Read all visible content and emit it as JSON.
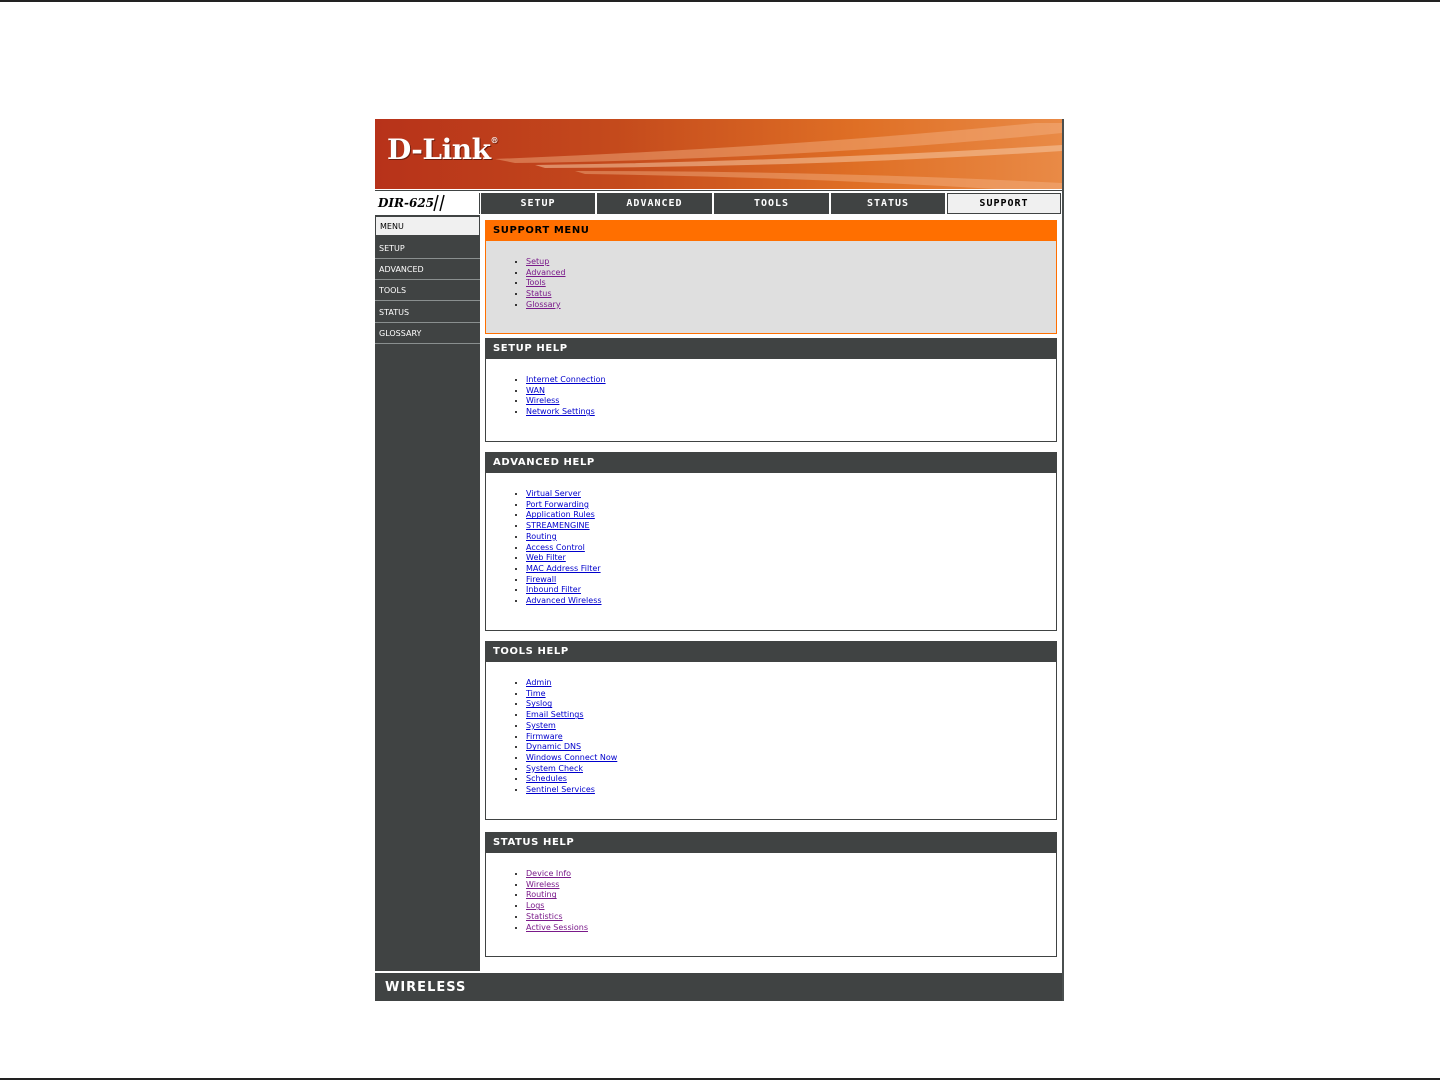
{
  "brand": {
    "logo_text": "D-Link",
    "model": "DIR-625"
  },
  "topnav": {
    "tabs": [
      {
        "label": "SETUP",
        "active": false
      },
      {
        "label": "ADVANCED",
        "active": false
      },
      {
        "label": "TOOLS",
        "active": false
      },
      {
        "label": "STATUS",
        "active": false
      },
      {
        "label": "SUPPORT",
        "active": true
      }
    ]
  },
  "sidebar": {
    "items": [
      {
        "label": "MENU",
        "active": true
      },
      {
        "label": "SETUP",
        "active": false
      },
      {
        "label": "ADVANCED",
        "active": false
      },
      {
        "label": "TOOLS",
        "active": false
      },
      {
        "label": "STATUS",
        "active": false
      },
      {
        "label": "GLOSSARY",
        "active": false
      }
    ]
  },
  "sections": [
    {
      "title": "SUPPORT MENU",
      "links": [
        {
          "label": "Setup",
          "visited": true
        },
        {
          "label": "Advanced",
          "visited": true
        },
        {
          "label": "Tools",
          "visited": true
        },
        {
          "label": "Status",
          "visited": true
        },
        {
          "label": "Glossary",
          "visited": true
        }
      ]
    },
    {
      "title": "SETUP HELP",
      "links": [
        {
          "label": "Internet Connection",
          "visited": false
        },
        {
          "label": "WAN",
          "visited": false
        },
        {
          "label": "Wireless",
          "visited": false
        },
        {
          "label": "Network Settings",
          "visited": false
        }
      ]
    },
    {
      "title": "ADVANCED HELP",
      "links": [
        {
          "label": "Virtual Server",
          "visited": false
        },
        {
          "label": "Port Forwarding",
          "visited": false
        },
        {
          "label": "Application Rules",
          "visited": false
        },
        {
          "label": "STREAMENGINE",
          "visited": false
        },
        {
          "label": "Routing",
          "visited": false
        },
        {
          "label": "Access Control",
          "visited": false
        },
        {
          "label": "Web Filter",
          "visited": false
        },
        {
          "label": "MAC Address Filter",
          "visited": false
        },
        {
          "label": "Firewall",
          "visited": false
        },
        {
          "label": "Inbound Filter",
          "visited": false
        },
        {
          "label": "Advanced Wireless",
          "visited": false
        }
      ]
    },
    {
      "title": "TOOLS HELP",
      "links": [
        {
          "label": "Admin",
          "visited": false
        },
        {
          "label": "Time",
          "visited": false
        },
        {
          "label": "Syslog",
          "visited": false
        },
        {
          "label": "Email Settings",
          "visited": false
        },
        {
          "label": "System",
          "visited": false
        },
        {
          "label": "Firmware",
          "visited": false
        },
        {
          "label": "Dynamic DNS",
          "visited": false
        },
        {
          "label": "Windows Connect Now",
          "visited": false
        },
        {
          "label": "System Check",
          "visited": false
        },
        {
          "label": "Schedules",
          "visited": false
        },
        {
          "label": "Sentinel Services",
          "visited": false
        }
      ]
    },
    {
      "title": "STATUS HELP",
      "links": [
        {
          "label": "Device Info",
          "visited": true
        },
        {
          "label": "Wireless",
          "visited": true
        },
        {
          "label": "Routing",
          "visited": true
        },
        {
          "label": "Logs",
          "visited": true
        },
        {
          "label": "Statistics",
          "visited": true
        },
        {
          "label": "Active Sessions",
          "visited": true
        }
      ]
    }
  ],
  "footer": {
    "label": "WIRELESS"
  },
  "colors": {
    "accent": "#ff6f00",
    "nav_dark": "#404343",
    "link": "#0000cc",
    "link_visited": "#7a1a8a"
  }
}
